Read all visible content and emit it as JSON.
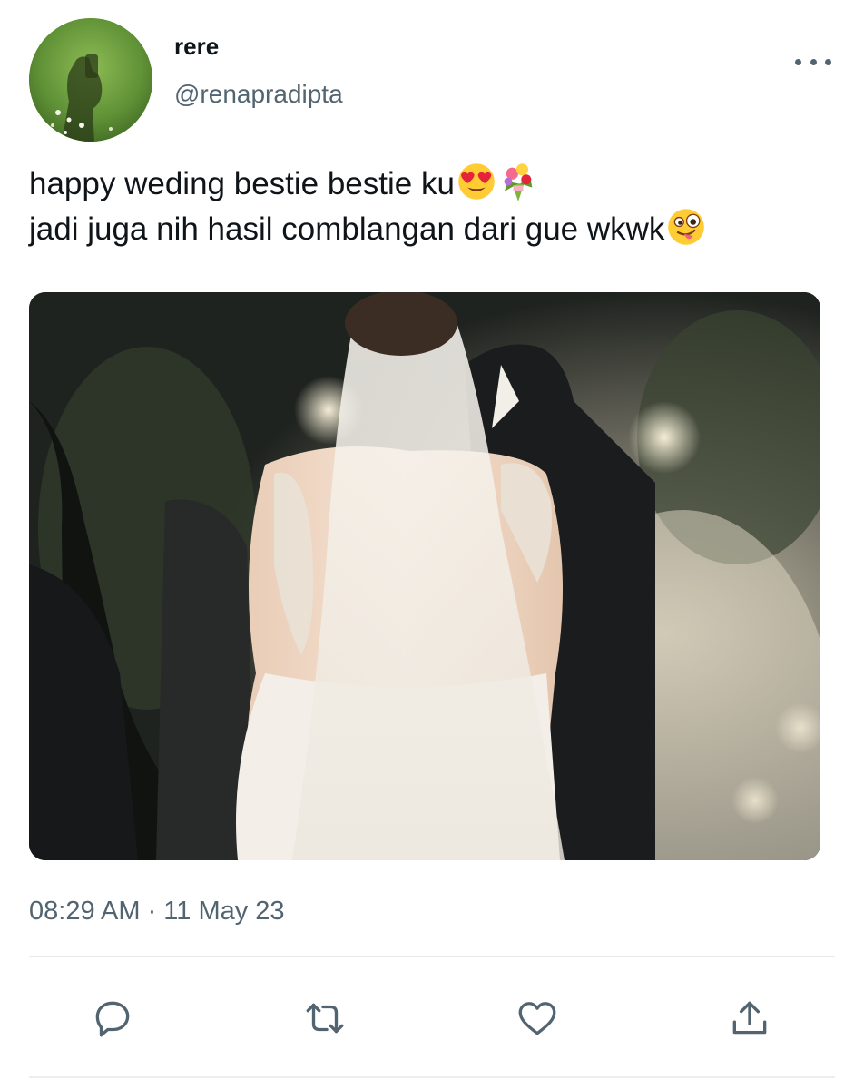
{
  "author": {
    "display_name": "rere",
    "handle": "@renapradipta",
    "avatar_icon": "avatar-grass-shadow"
  },
  "tweet": {
    "line1": "happy weding bestie bestie ku",
    "line1_emojis": [
      "heart-eyes-emoji",
      "bouquet-emoji"
    ],
    "line2": "jadi juga nih hasil comblangan dari gue wkwk",
    "line2_emojis": [
      "winking-tongue-emoji"
    ],
    "timestamp": "08:29 AM · 11 May 23"
  },
  "media": {
    "icon": "wedding-photo-bride-groom"
  },
  "menu": {
    "more_icon": "more-horizontal-icon"
  },
  "actions": [
    {
      "name": "reply",
      "icon": "reply-icon"
    },
    {
      "name": "retweet",
      "icon": "retweet-icon"
    },
    {
      "name": "like",
      "icon": "heart-icon"
    },
    {
      "name": "share",
      "icon": "share-icon"
    }
  ],
  "colors": {
    "text": "#0f1419",
    "secondary": "#536471",
    "divider": "#e6e9ec"
  }
}
